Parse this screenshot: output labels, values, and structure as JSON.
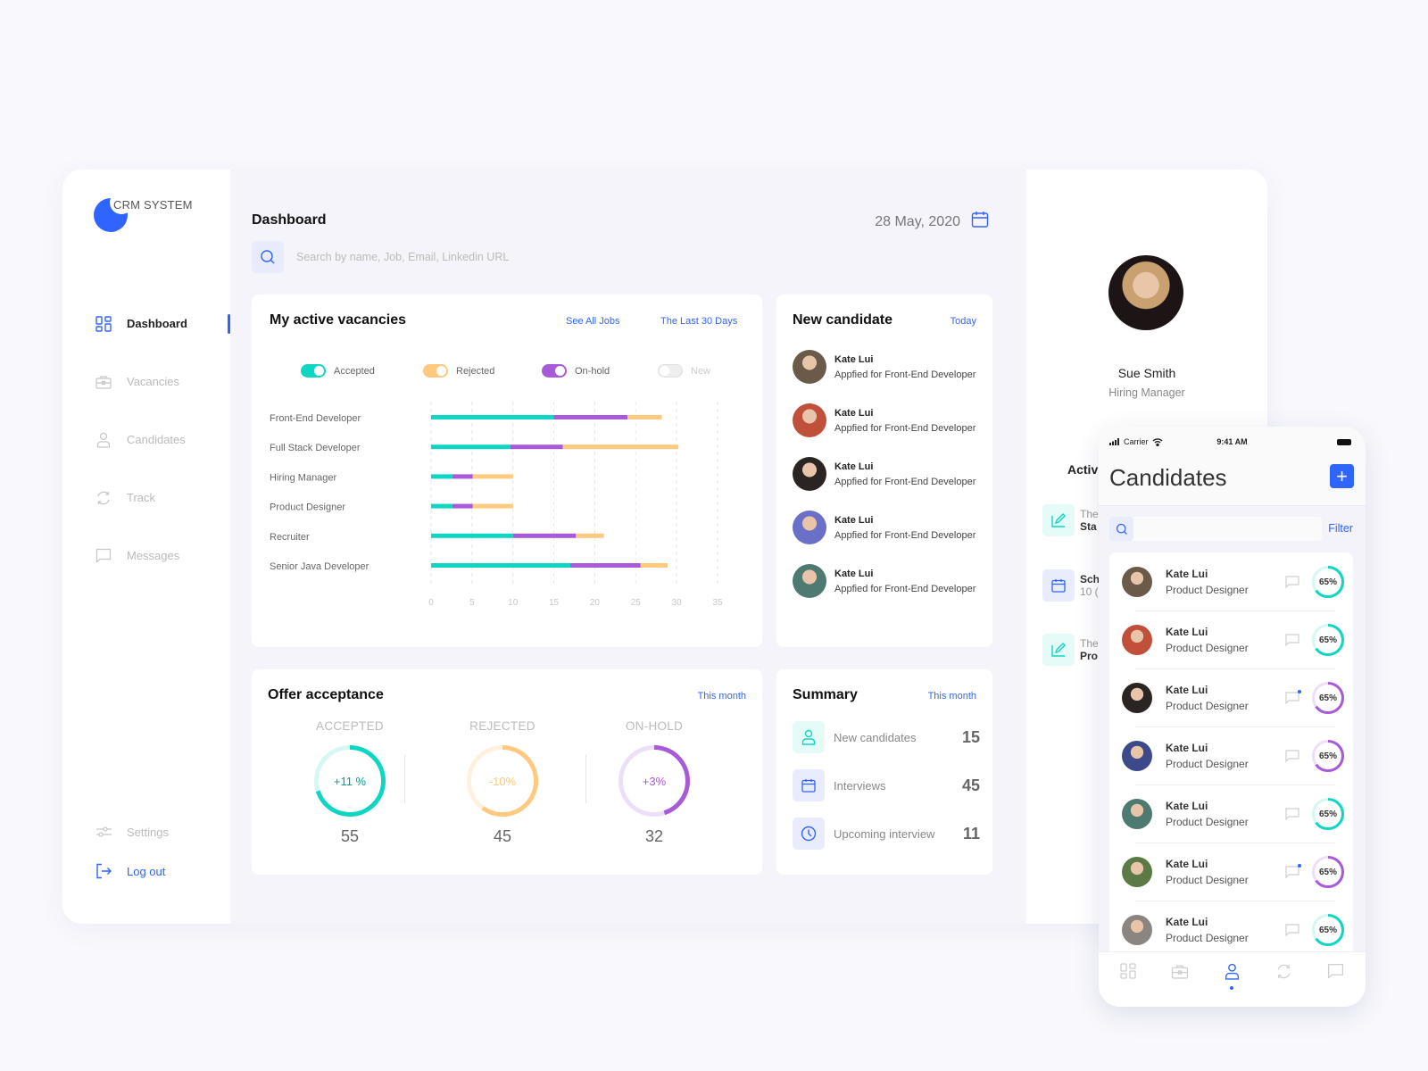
{
  "app": {
    "logo_text": "CRM SYSTEM",
    "brand_color": "#2f64ff"
  },
  "sidebar": {
    "items": [
      {
        "label": "Dashboard",
        "icon": "dashboard-icon",
        "active": true
      },
      {
        "label": "Vacancies",
        "icon": "briefcase-icon",
        "active": false
      },
      {
        "label": "Candidates",
        "icon": "user-icon",
        "active": false
      },
      {
        "label": "Track",
        "icon": "refresh-icon",
        "active": false
      },
      {
        "label": "Messages",
        "icon": "chat-icon",
        "active": false
      }
    ],
    "settings_label": "Settings",
    "logout_label": "Log out"
  },
  "header": {
    "title": "Dashboard",
    "date": "28 May, 2020",
    "search_placeholder": "Search by name, Job, Email, Linkedin URL"
  },
  "vacancies": {
    "title": "My active vacancies",
    "see_all_label": "See All Jobs",
    "period_label": "The Last 30 Days",
    "legend": [
      {
        "label": "Accepted",
        "color": "#0fd6c2",
        "on": true
      },
      {
        "label": "Rejected",
        "color": "#ffc97f",
        "on": true
      },
      {
        "label": "On-hold",
        "color": "#a85ad8",
        "on": true
      },
      {
        "label": "New",
        "color": "#e6e6e6",
        "on": false
      }
    ]
  },
  "chart_data": {
    "type": "bar",
    "orientation": "horizontal",
    "stacked": true,
    "title": "My active vacancies",
    "categories": [
      "Front-End Developer",
      "Full Stack Developer",
      "Hiring Manager",
      "Product Designer",
      "Recruiter",
      "Senior Java Developer"
    ],
    "series": [
      {
        "name": "Accepted",
        "color": "#0fd6c2",
        "values": [
          15,
          9.7,
          2.6,
          2.6,
          10,
          17
        ]
      },
      {
        "name": "On-hold",
        "color": "#a85ad8",
        "values": [
          9,
          6.4,
          2.5,
          2.5,
          7.7,
          8.6
        ]
      },
      {
        "name": "Rejected",
        "color": "#ffc97f",
        "values": [
          4.2,
          14.1,
          4.9,
          4.9,
          3.4,
          3.3
        ]
      }
    ],
    "xticks": [
      0,
      5,
      10,
      15,
      20,
      25,
      30,
      35
    ],
    "xlim": [
      0,
      35
    ],
    "grid": "vertical dashed"
  },
  "new_candidates": {
    "title": "New candidate",
    "period_label": "Today",
    "items": [
      {
        "name": "Kate Lui",
        "subtitle": "Appfied for Front-End Developer",
        "avatar_color": "#6b5a4a"
      },
      {
        "name": "Kate Lui",
        "subtitle": "Appfied for Front-End Developer",
        "avatar_color": "#c0503a"
      },
      {
        "name": "Kate Lui",
        "subtitle": "Appfied for Front-End Developer",
        "avatar_color": "#2a2522"
      },
      {
        "name": "Kate Lui",
        "subtitle": "Appfied for Front-End Developer",
        "avatar_color": "#6a6fc8"
      },
      {
        "name": "Kate Lui",
        "subtitle": "Appfied for Front-End Developer",
        "avatar_color": "#4f7a72"
      }
    ]
  },
  "offer": {
    "title": "Offer acceptance",
    "period_label": "This month",
    "rings": [
      {
        "label": "ACCEPTED",
        "change": "+11 %",
        "count": "55",
        "progress": 0.7,
        "color": "#0fd6c2",
        "track": "#d5f8f4",
        "text_color": "#0a9c8e"
      },
      {
        "label": "REJECTED",
        "change": "-10%",
        "count": "45",
        "progress": 0.6,
        "color": "#ffc97f",
        "track": "#fff1de",
        "text_color": "#ffc97f"
      },
      {
        "label": "ON-HOLD",
        "change": "+3%",
        "count": "32",
        "progress": 0.45,
        "color": "#a85ad8",
        "track": "#eedff8",
        "text_color": "#a85ad8"
      }
    ]
  },
  "summary": {
    "title": "Summary",
    "period_label": "This month",
    "rows": [
      {
        "label": "New candidates",
        "value": "15",
        "icon": "user-icon"
      },
      {
        "label": "Interviews",
        "value": "45",
        "icon": "calendar-icon"
      },
      {
        "label": "Upcoming interview",
        "value": "11",
        "icon": "clock-icon"
      }
    ]
  },
  "profile": {
    "name": "Sue Smith",
    "role": "Hiring Manager",
    "activity_title": "Activ",
    "activity": [
      {
        "line1": "The",
        "line2": "Sta",
        "icon": "edit-icon"
      },
      {
        "line1": "Sch",
        "line2": "10 (",
        "icon": "calendar-icon"
      },
      {
        "line1": "The",
        "line2": "Pro",
        "icon": "edit-icon"
      }
    ]
  },
  "mobile": {
    "carrier": "Carrier",
    "time": "9:41 AM",
    "title": "Candidates",
    "add_label": "+",
    "search_value": "",
    "filter_label": "Filter",
    "candidates": [
      {
        "name": "Kate Lui",
        "role": "Product Designer",
        "score": "65%",
        "progress": 0.65,
        "ring_color": "#0fd6c2",
        "unread": false,
        "avatar_color": "#6b5a4a"
      },
      {
        "name": "Kate Lui",
        "role": "Product Designer",
        "score": "65%",
        "progress": 0.65,
        "ring_color": "#0fd6c2",
        "unread": false,
        "avatar_color": "#c0503a"
      },
      {
        "name": "Kate Lui",
        "role": "Product Designer",
        "score": "65%",
        "progress": 0.65,
        "ring_color": "#a85ad8",
        "unread": true,
        "avatar_color": "#2a2522"
      },
      {
        "name": "Kate Lui",
        "role": "Product Designer",
        "score": "65%",
        "progress": 0.65,
        "ring_color": "#a85ad8",
        "unread": false,
        "avatar_color": "#3d4a8a"
      },
      {
        "name": "Kate Lui",
        "role": "Product Designer",
        "score": "65%",
        "progress": 0.65,
        "ring_color": "#0fd6c2",
        "unread": false,
        "avatar_color": "#4f7a72"
      },
      {
        "name": "Kate Lui",
        "role": "Product Designer",
        "score": "65%",
        "progress": 0.65,
        "ring_color": "#a85ad8",
        "unread": true,
        "avatar_color": "#5b7a45"
      },
      {
        "name": "Kate Lui",
        "role": "Product Designer",
        "score": "65%",
        "progress": 0.65,
        "ring_color": "#0fd6c2",
        "unread": false,
        "avatar_color": "#8a8580"
      }
    ],
    "tabs": [
      "dashboard-icon",
      "briefcase-icon",
      "user-icon",
      "refresh-icon",
      "chat-icon"
    ],
    "active_tab": 2
  }
}
